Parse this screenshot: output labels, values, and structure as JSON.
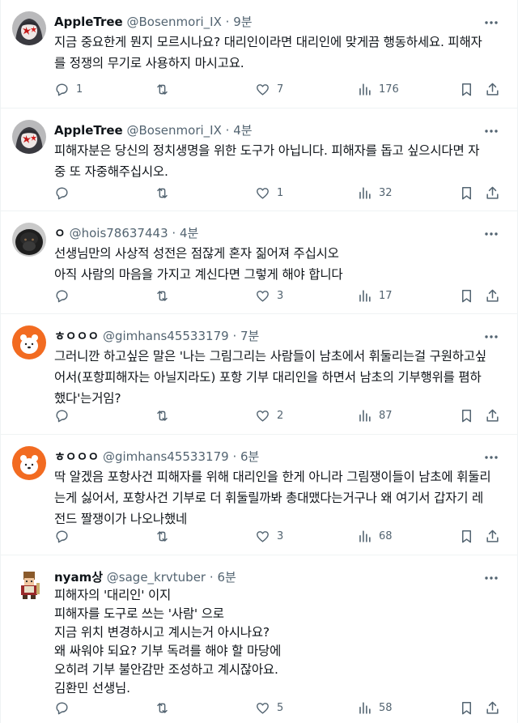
{
  "posts": [
    {
      "name": "AppleTree",
      "handle": "@Bosenmori_IX",
      "sep": "·",
      "time": "9분",
      "lines": [
        "지금 중요한게 뭔지 모르시나요? 대리인이라면 대리인에 맞게끔 행동하세요. 피해자",
        "를 정쟁의 무기로 사용하지 마시고요."
      ],
      "replies": "1",
      "retweets": "",
      "likes": "7",
      "views": "176",
      "avatar": "anime-girl-dark"
    },
    {
      "name": "AppleTree",
      "handle": "@Bosenmori_IX",
      "sep": "·",
      "time": "4분",
      "lines": [
        "피해자분은 당신의 정치생명을 위한 도구가 아닙니다.  피해자를 돕고 싶으시다면 자",
        "중 또 자중해주십시오."
      ],
      "replies": "",
      "retweets": "",
      "likes": "1",
      "views": "32",
      "avatar": "anime-girl-dark"
    },
    {
      "name": "ㅇ",
      "handle": "@hois78637443",
      "sep": "·",
      "time": "4분",
      "lines": [
        "선생님만의 사상적 성전은 점잖게 혼자 짊어져 주십시오",
        "아직 사람의 마음을 가지고 계신다면 그렇게 해야 합니다"
      ],
      "replies": "",
      "retweets": "",
      "likes": "3",
      "views": "17",
      "avatar": "gorilla"
    },
    {
      "name": "ㅎㅇㅇㅇ",
      "handle": "@gimhans45533179",
      "sep": "·",
      "time": "7분",
      "lines": [
        "그러니깐 하고싶은 말은 '나는 그림그리는 사람들이 남초에서 휘둘리는걸 구원하고싶",
        "어서(포항피해자는 아닐지라도)  포항 기부 대리인을 하면서 남초의 기부행위를 폄하",
        "했다'는거임?"
      ],
      "replies": "",
      "retweets": "",
      "likes": "2",
      "views": "87",
      "avatar": "bear-orange"
    },
    {
      "name": "ㅎㅇㅇㅇ",
      "handle": "@gimhans45533179",
      "sep": "·",
      "time": "6분",
      "lines": [
        "딱 알겠음 포항사건 피해자를 위해 대리인을 한게 아니라 그림쟁이들이 남초에 휘둘리",
        "는게 싫어서, 포항사건 기부로 더 휘둘릴까봐 총대맸다는거구나 왜 여기서 갑자기 레",
        "전드 짤쟁이가 나오나했네"
      ],
      "replies": "",
      "retweets": "",
      "likes": "3",
      "views": "68",
      "avatar": "bear-orange"
    },
    {
      "name": "nyam상",
      "handle": "@sage_krvtuber",
      "sep": "·",
      "time": "6분",
      "lines": [
        "피해자의 '대리인' 이지",
        "피해자를 도구로 쓰는 '사람' 으로",
        "지금 위치 변경하시고 계시는거 아시나요?",
        "왜 싸워야 되요? 기부 독려를 해야 할 마당에",
        "오히려 기부 불안감만 조성하고 계시잖아요.",
        "김환민 선생님."
      ],
      "replies": "",
      "retweets": "",
      "likes": "5",
      "views": "58",
      "avatar": "pixel-warrior"
    }
  ]
}
